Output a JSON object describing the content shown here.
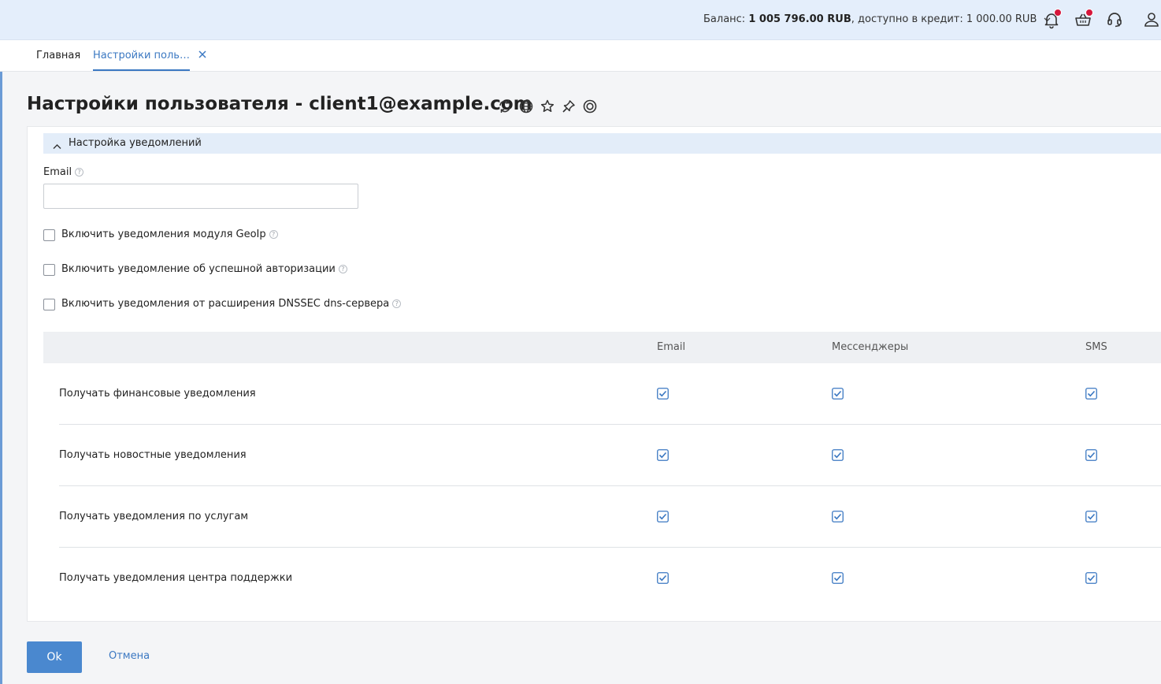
{
  "header": {
    "balance_label": "Баланс:",
    "balance_value": "1 005 796.00 RUB",
    "credit_label": ", доступно в кредит:",
    "credit_value": "1 000.00 RUB",
    "icons": [
      "bell-icon",
      "basket-icon",
      "headset-icon",
      "user-icon"
    ],
    "badge_color": "#d6173c"
  },
  "tabs": [
    {
      "label": "Главная"
    },
    {
      "label": "Настройки поль…"
    }
  ],
  "page": {
    "title": "Настройки пользователя - client1@example.com",
    "title_icons": [
      "refresh-icon",
      "globe-icon",
      "star-icon",
      "pin-icon",
      "help-circle-icon"
    ]
  },
  "section": {
    "title": "Настройка уведомлений"
  },
  "form": {
    "email_label": "Email",
    "email_value": "",
    "checkboxes": [
      {
        "label": "Включить уведомления модуля GeoIp",
        "checked": false
      },
      {
        "label": "Включить уведомление об успешной авторизации",
        "checked": false
      },
      {
        "label": "Включить уведомления от расширения DNSSEC dns-сервера",
        "checked": false
      }
    ]
  },
  "table": {
    "columns": [
      "",
      "Email",
      "Мессенджеры",
      "SMS"
    ],
    "rows": [
      {
        "label": "Получать финансовые уведомления",
        "email": true,
        "messengers": true,
        "sms": true
      },
      {
        "label": "Получать новостные уведомления",
        "email": true,
        "messengers": true,
        "sms": true
      },
      {
        "label": "Получать уведомления по услугам",
        "email": true,
        "messengers": true,
        "sms": true
      },
      {
        "label": "Получать уведомления центра поддержки",
        "email": true,
        "messengers": true,
        "sms": true
      }
    ]
  },
  "footer": {
    "ok_label": "Ok",
    "cancel_label": "Отмена"
  },
  "colors": {
    "accent": "#3b78c2",
    "topbar": "#e4eefb",
    "button": "#4a88cf"
  }
}
